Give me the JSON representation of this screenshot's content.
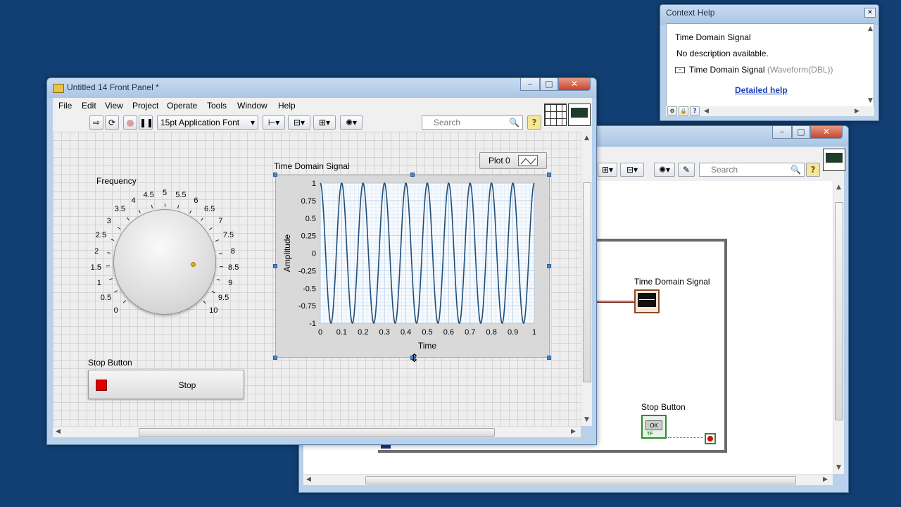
{
  "front_panel": {
    "title": "Untitled 14 Front Panel *",
    "menu": [
      "File",
      "Edit",
      "View",
      "Project",
      "Operate",
      "Tools",
      "Window",
      "Help"
    ],
    "font_select": "15pt Application Font",
    "search_placeholder": "Search",
    "help_btn": "?",
    "frequency_label": "Frequency",
    "dial_scale": [
      "0",
      "0.5",
      "1",
      "1.5",
      "2",
      "2.5",
      "3",
      "3.5",
      "4",
      "4.5",
      "5",
      "5.5",
      "6",
      "6.5",
      "7",
      "7.5",
      "8",
      "8.5",
      "9",
      "9.5",
      "10"
    ],
    "dial_value": 8.5,
    "graph_label": "Time Domain Signal",
    "plot_legend": "Plot 0",
    "stop_label": "Stop Button",
    "stop_button": "Stop"
  },
  "chart_data": {
    "type": "line",
    "title": "",
    "xlabel": "Time",
    "ylabel": "Amplitude",
    "xlim": [
      0,
      1
    ],
    "ylim": [
      -1,
      1
    ],
    "x_ticks": [
      "0",
      "0.1",
      "0.2",
      "0.3",
      "0.4",
      "0.5",
      "0.6",
      "0.7",
      "0.8",
      "0.9",
      "1"
    ],
    "y_ticks": [
      "1",
      "0.75",
      "0.5",
      "0.25",
      "0",
      "-0.25",
      "-0.5",
      "-0.75",
      "-1"
    ],
    "grid": true,
    "series": [
      {
        "name": "Plot 0",
        "function": "sine",
        "frequency": 10,
        "amplitude": 1,
        "color": "#1f4e79"
      }
    ]
  },
  "context_help": {
    "title": "Context Help",
    "heading": "Time Domain Signal",
    "description": "No description available.",
    "term_name": "Time Domain Signal",
    "term_type": "(Waveform(DBL))",
    "link": "Detailed help",
    "help_btn": "?"
  },
  "block_diagram": {
    "search_placeholder": "Search",
    "help_btn": "?",
    "signal_label": "Time Domain Signal",
    "stop_label": "Stop Button",
    "terminal_ok": "OK",
    "terminal_tf": "TF"
  }
}
